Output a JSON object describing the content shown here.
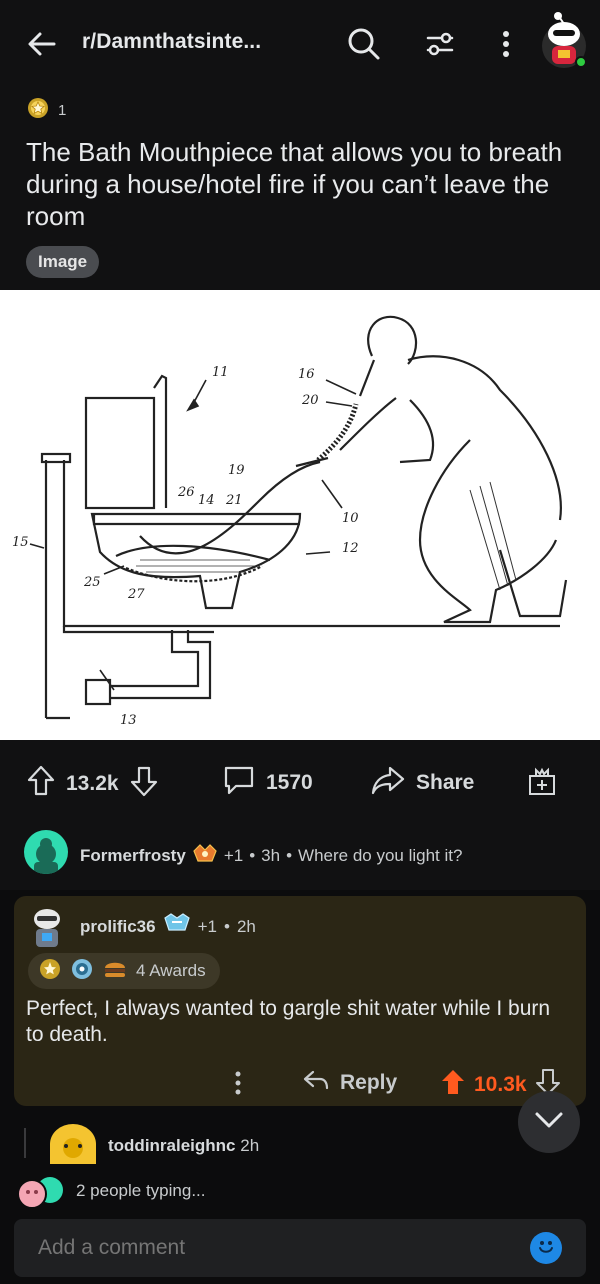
{
  "header": {
    "subreddit": "r/Damnthatsinte...",
    "icons": [
      "back-arrow-icon",
      "search-icon",
      "filter-icon",
      "more-vertical-icon",
      "user-avatar"
    ]
  },
  "post": {
    "award_count": "1",
    "title": "The Bath Mouthpiece that allows you to breath during a house/hotel fire if you can’t leave the room",
    "flair": "Image",
    "image_labels": [
      "11",
      "16",
      "20",
      "19",
      "26",
      "14",
      "21",
      "10",
      "12",
      "15",
      "25",
      "27",
      "13"
    ]
  },
  "actions": {
    "upvotes": "13.2k",
    "comments": "1570",
    "share_label": "Share"
  },
  "comments": [
    {
      "username": "Formerfrosty",
      "award_plus": "+1",
      "age": "3h",
      "text": "Where do you light it?"
    },
    {
      "username": "prolific36",
      "award_plus": "+1",
      "age": "2h",
      "awards_label": "4 Awards",
      "text": "Perfect, I always wanted to gargle shit water while I burn to death.",
      "reply_label": "Reply",
      "votes": "10.3k"
    },
    {
      "username": "toddinraleighnc",
      "age": "2h"
    }
  ],
  "typing_indicator": "2 people typing...",
  "composer": {
    "placeholder": "Add a comment"
  },
  "colors": {
    "background": "#000000",
    "surface": "#111112",
    "highlight": "#2b2615",
    "upvote_orange": "#ff5a1f",
    "emoji_blue": "#1e88e5"
  }
}
